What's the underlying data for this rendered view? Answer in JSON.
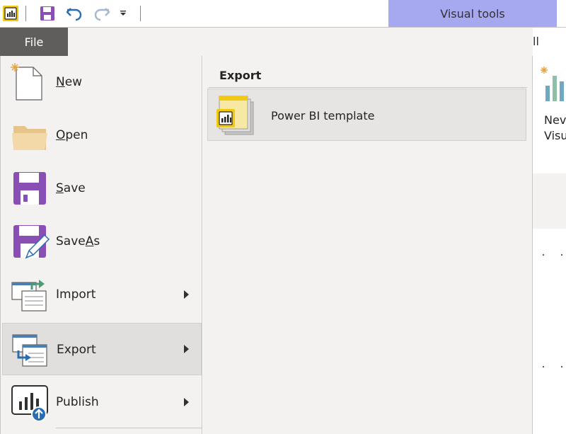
{
  "titlebar": {
    "context_tab": "Visual tools",
    "ribbon_fragment": "ll"
  },
  "file_tab": {
    "label": "File"
  },
  "menu": {
    "items": [
      {
        "id": "new",
        "pre": "",
        "u": "N",
        "post": "ew",
        "icon": "new-file-icon",
        "arrow": false
      },
      {
        "id": "open",
        "pre": "",
        "u": "O",
        "post": "pen",
        "icon": "folder-icon",
        "arrow": false
      },
      {
        "id": "save",
        "pre": "",
        "u": "S",
        "post": "ave",
        "icon": "floppy-disk-icon",
        "arrow": false
      },
      {
        "id": "save-as",
        "pre": "Save ",
        "u": "A",
        "post": "s",
        "icon": "floppy-disk-pencil-icon",
        "arrow": false
      },
      {
        "id": "import",
        "pre": "Import",
        "u": "",
        "post": "",
        "icon": "import-icon",
        "arrow": true
      },
      {
        "id": "export",
        "pre": "Export",
        "u": "",
        "post": "",
        "icon": "export-icon",
        "arrow": true,
        "selected": true
      },
      {
        "id": "publish",
        "pre": "Publish",
        "u": "",
        "post": "",
        "icon": "publish-icon",
        "arrow": true
      }
    ]
  },
  "panel": {
    "title": "Export",
    "options": [
      {
        "label": "Power BI template",
        "icon": "powerbi-template-icon"
      }
    ]
  },
  "background": {
    "new_visual_line1": "Nev",
    "new_visual_line2": "Visu"
  },
  "colors": {
    "accent_purple": "#8a4fb5",
    "powerbi_yellow": "#f2c811",
    "context_tab": "#a7a9f0",
    "file_tab": "#605e5c"
  }
}
